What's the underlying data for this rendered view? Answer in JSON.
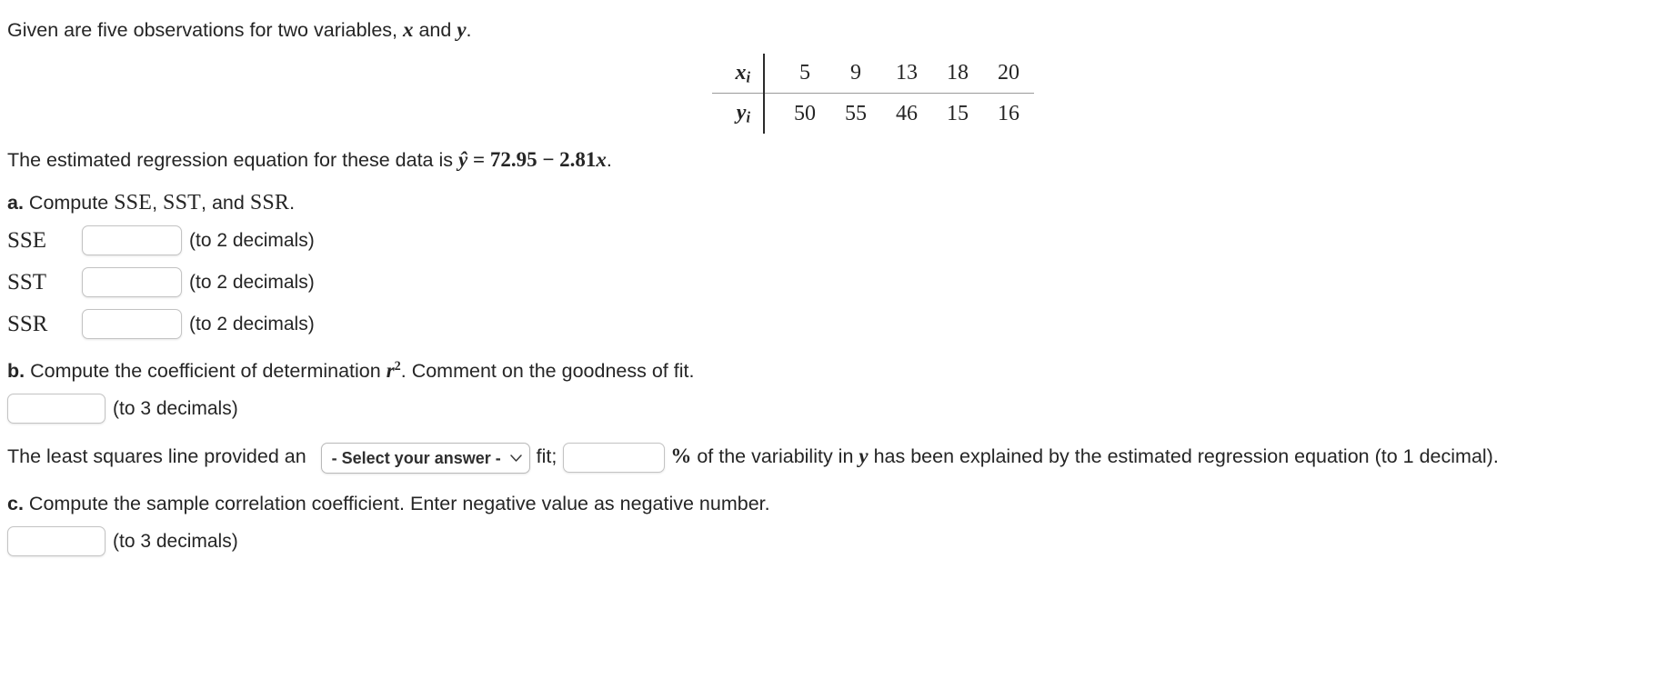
{
  "intro": {
    "text_before": "Given are five observations for two variables, ",
    "var_x": "x",
    "text_mid": " and ",
    "var_y": "y",
    "text_after": "."
  },
  "table": {
    "row_labels": [
      "x",
      "y"
    ],
    "subscript": "i",
    "x_values": [
      "5",
      "9",
      "13",
      "18",
      "20"
    ],
    "y_values": [
      "50",
      "55",
      "46",
      "15",
      "16"
    ]
  },
  "equation": {
    "text_before": "The estimated regression equation for these data is ",
    "yhat": "ŷ",
    "equals": " = ",
    "intercept": "72.95",
    "operator": " − ",
    "slope": "2.81",
    "var": "x",
    "period": "."
  },
  "parts": {
    "a": {
      "letter": "a.",
      "text": " Compute ",
      "term1": "SSE",
      "sep1": ", ",
      "term2": "SST",
      "sep2": ", and ",
      "term3": "SSR",
      "period": ".",
      "rows": [
        {
          "label": "SSE",
          "value": "",
          "hint": "(to 2 decimals)"
        },
        {
          "label": "SST",
          "value": "",
          "hint": "(to 2 decimals)"
        },
        {
          "label": "SSR",
          "value": "",
          "hint": "(to 2 decimals)"
        }
      ]
    },
    "b": {
      "letter": "b.",
      "text_before": " Compute the coefficient of determination ",
      "symbol": "r",
      "exponent": "2",
      "text_after": ". Comment on the goodness of fit.",
      "input_value": "",
      "hint": "(to 3 decimals)",
      "sentence_1": "The least squares line provided an ",
      "dropdown": {
        "selected": "- Select your answer -",
        "options": [
          "- Select your answer -"
        ],
        "icon": "chevron-down-icon"
      },
      "sentence_2": "fit;",
      "pct_value": "",
      "pct_symbol": "%",
      "sentence_3": " of the variability in ",
      "var_y": "y",
      "sentence_4": " has been explained by the estimated regression equation (to 1 decimal)."
    },
    "c": {
      "letter": "c.",
      "text": " Compute the sample correlation coefficient. Enter negative value as negative number.",
      "input_value": "",
      "hint": "(to 3 decimals)"
    }
  },
  "colors": {
    "text": "#252525",
    "border": "#c3c3c3",
    "rule": "#9a9a9a"
  }
}
